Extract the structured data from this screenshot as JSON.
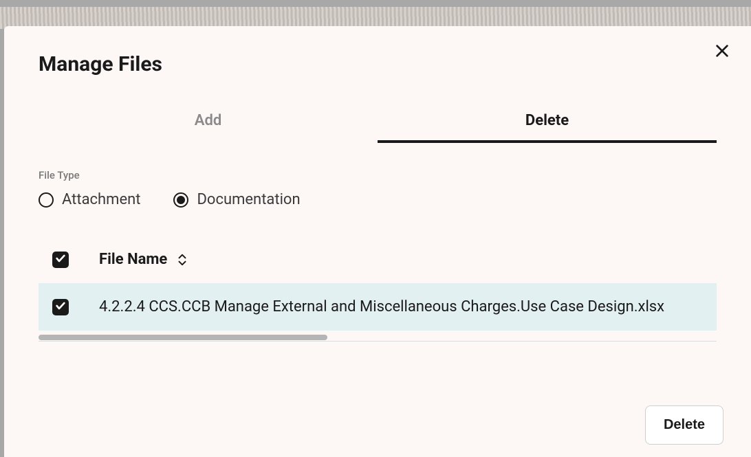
{
  "modal": {
    "title": "Manage Files",
    "tabs": {
      "add": "Add",
      "delete": "Delete"
    },
    "file_type": {
      "label": "File Type",
      "options": {
        "attachment": "Attachment",
        "documentation": "Documentation"
      },
      "selected": "documentation"
    },
    "table": {
      "column_header": "File Name",
      "rows": [
        {
          "name": "4.2.2.4 CCS.CCB Manage External and Miscellaneous Charges.Use Case Design.xlsx",
          "checked": true
        }
      ],
      "select_all_checked": true
    },
    "actions": {
      "delete_button": "Delete"
    }
  }
}
